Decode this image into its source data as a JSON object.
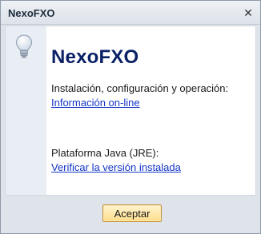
{
  "window": {
    "title": "NexoFXO",
    "close_symbol": "✕"
  },
  "content": {
    "icon": "lightbulb-icon",
    "app_name": "NexoFXO",
    "install_label": "Instalación, configuración y operación:",
    "install_link": "Información on-line",
    "java_label": "Plataforma Java (JRE):",
    "java_link": "Verificar la versión instalada"
  },
  "footer": {
    "accept_label": "Aceptar"
  },
  "colors": {
    "title_accent": "#0b2166",
    "link": "#1435c8",
    "button_fill": "#ffdf8c"
  }
}
